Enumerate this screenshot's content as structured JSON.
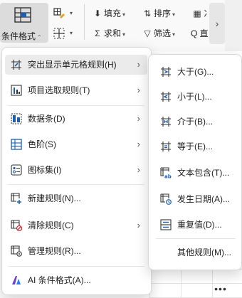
{
  "ribbon": {
    "conditional_format_label": "条件格式",
    "fill_label": "填充",
    "sort_label": "排序",
    "sum_label": "求和",
    "filter_label": "筛选",
    "truncated_1": "冫",
    "truncated_2": "Q 直",
    "more_chevron": "›"
  },
  "main_menu": {
    "items": [
      {
        "label": "突出显示单元格规则(H)",
        "icon": "highlight-cells-icon",
        "has_submenu": true
      },
      {
        "label": "项目选取规则(T)",
        "icon": "top-bottom-rules-icon",
        "has_submenu": true
      },
      {
        "label": "数据条(D)",
        "icon": "data-bars-icon",
        "has_submenu": true
      },
      {
        "label": "色阶(S)",
        "icon": "color-scales-icon",
        "has_submenu": true
      },
      {
        "label": "图标集(I)",
        "icon": "icon-sets-icon",
        "has_submenu": true
      },
      {
        "label": "新建规则(N)...",
        "icon": "new-rule-icon",
        "has_submenu": false
      },
      {
        "label": "清除规则(C)",
        "icon": "clear-rules-icon",
        "has_submenu": true
      },
      {
        "label": "管理规则(R)...",
        "icon": "manage-rules-icon",
        "has_submenu": false
      },
      {
        "label": "AI 条件格式(A)...",
        "icon": "ai-icon",
        "has_submenu": false
      }
    ]
  },
  "sub_menu": {
    "items": [
      {
        "label": "大于(G)...",
        "icon": "greater-than-icon"
      },
      {
        "label": "小于(L)...",
        "icon": "less-than-icon"
      },
      {
        "label": "介于(B)...",
        "icon": "between-icon"
      },
      {
        "label": "等于(E)...",
        "icon": "equal-to-icon"
      },
      {
        "label": "文本包含(T)...",
        "icon": "text-contains-icon"
      },
      {
        "label": "发生日期(A)...",
        "icon": "date-occurring-icon"
      },
      {
        "label": "重复值(D)...",
        "icon": "duplicate-values-icon"
      },
      {
        "label": "其他规则(M)...",
        "icon": ""
      }
    ]
  },
  "status": {
    "more": "•••"
  },
  "colors": {
    "accent": "#1a5fb4",
    "ai_purple": "#6b3fd4",
    "ai_blue": "#2b7bff",
    "clear_red": "#d13438"
  }
}
